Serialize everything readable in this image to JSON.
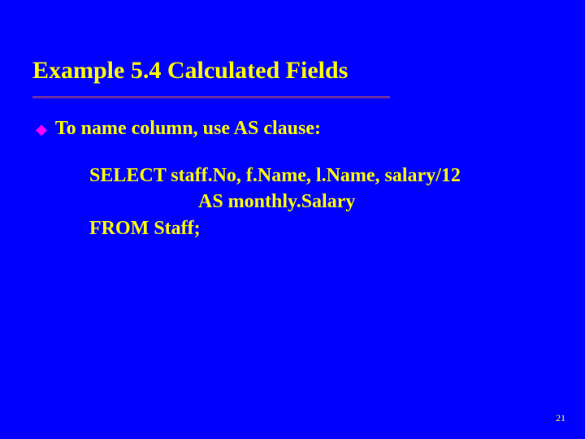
{
  "slide": {
    "title": "Example 5.4  Calculated Fields",
    "bullet": "To name column, use AS clause:",
    "code": {
      "line1": "SELECT staff.No, f.Name, l.Name, salary/12",
      "line2": "AS monthly.Salary",
      "line3": "FROM Staff;"
    },
    "page_number": "21"
  }
}
